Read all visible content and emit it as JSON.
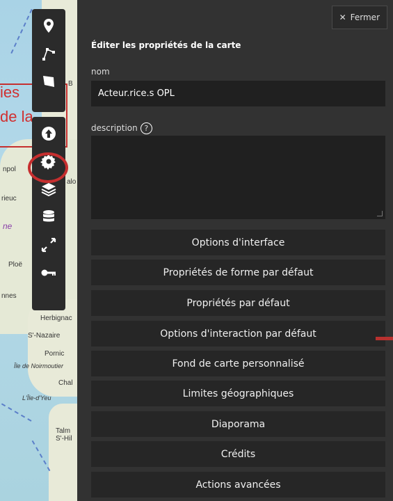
{
  "map": {
    "places": [
      "Herbignac",
      "S'-Nazaire",
      "Pornic",
      "Île de Noirmoutier",
      "Chal",
      "L'Île-d'Yeu",
      "Talm",
      "S'-Hil",
      "Ploë",
      "nnes",
      "rieuc",
      "npol",
      "ne",
      "alo",
      "B"
    ],
    "overlay_fragments": [
      "ies",
      "de la"
    ]
  },
  "toolbar": {
    "top_tools": [
      "marker-icon",
      "polyline-icon",
      "polygon-icon"
    ],
    "bottom_tools": [
      "upload-icon",
      "gear-icon",
      "layers-icon",
      "database-icon",
      "resize-icon",
      "key-icon"
    ]
  },
  "panel": {
    "close_label": "Fermer",
    "title": "Éditer les propriétés de la carte",
    "name_label": "nom",
    "name_value": "Acteur.rice.s OPL",
    "description_label": "description",
    "help_glyph": "?",
    "buttons": [
      "Options d'interface",
      "Propriétés de forme par défaut",
      "Propriétés par défaut",
      "Options d'interaction par défaut",
      "Fond de carte personnalisé",
      "Limites géographiques",
      "Diaporama",
      "Crédits",
      "Actions avancées"
    ]
  },
  "colors": {
    "panel_bg": "#323232",
    "button_bg": "#262626",
    "input_bg": "#202020",
    "annotation_red": "#c62f2f"
  }
}
